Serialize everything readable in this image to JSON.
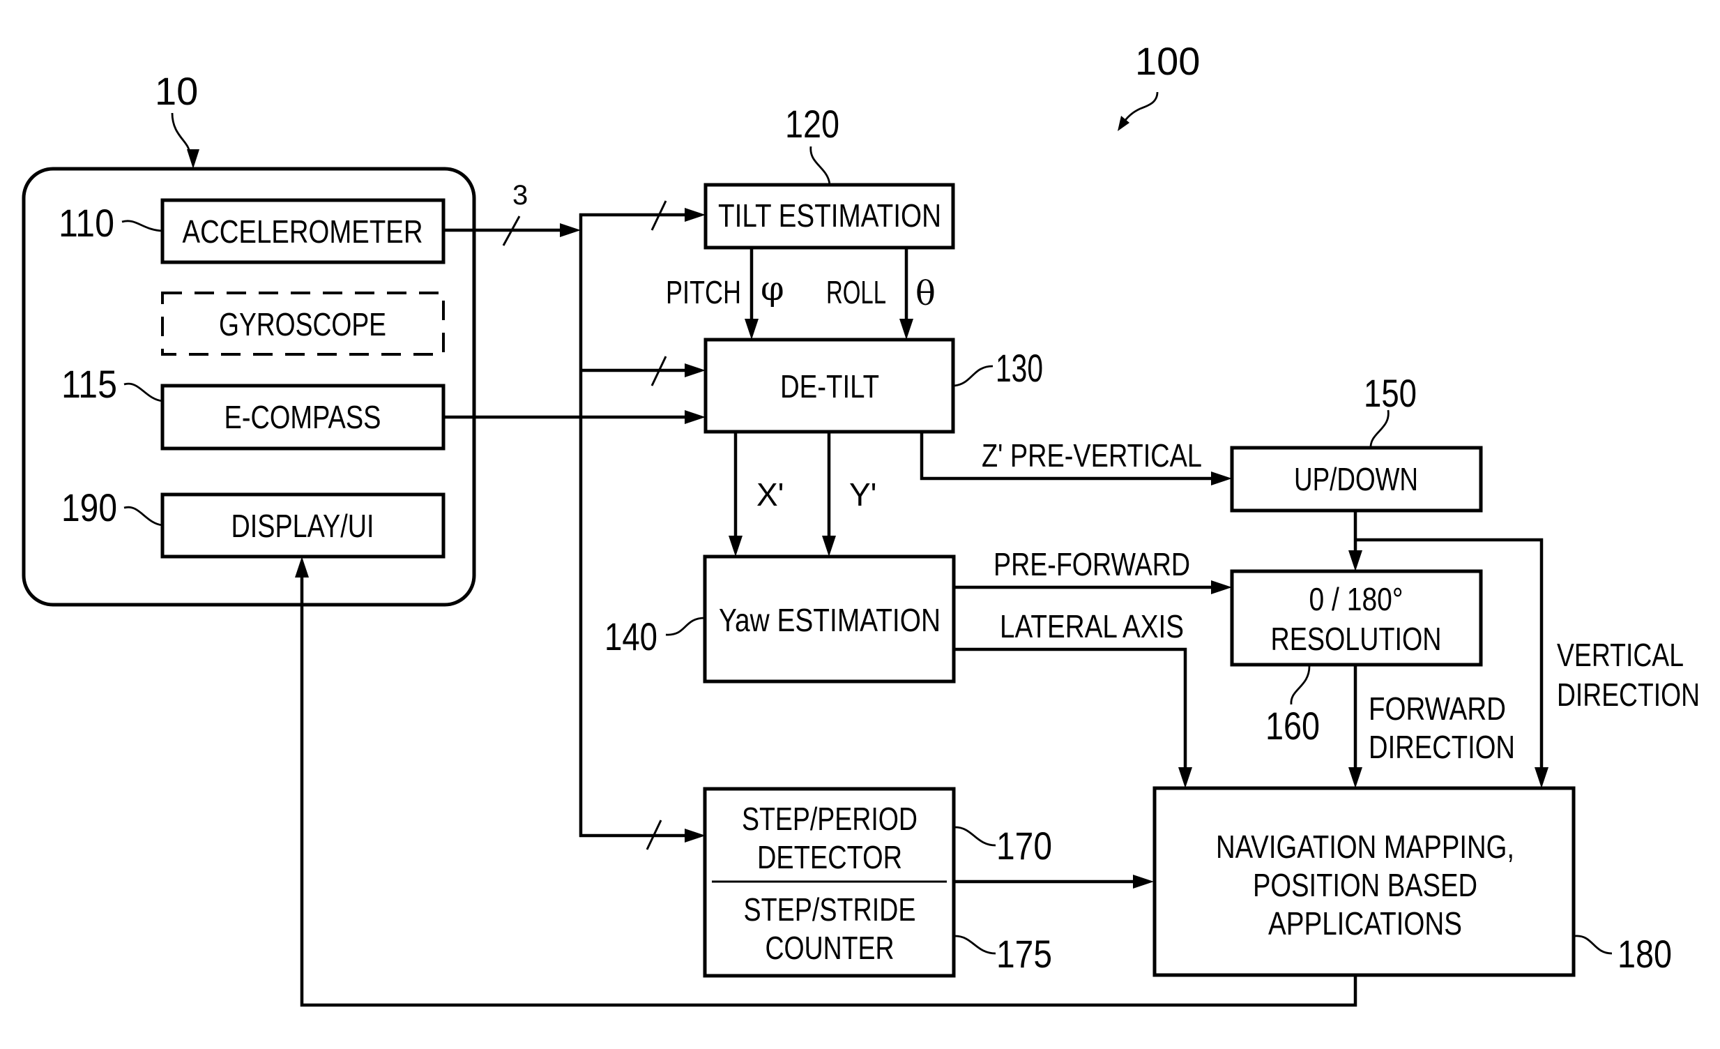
{
  "figure": {
    "reference": "100",
    "device": {
      "reference": "10",
      "components": [
        {
          "id": "accelerometer",
          "reference": "110",
          "label": "ACCELEROMETER",
          "optional": false
        },
        {
          "id": "gyroscope",
          "reference": "",
          "label": "GYROSCOPE",
          "optional": true
        },
        {
          "id": "ecompass",
          "reference": "115",
          "label": "E-COMPASS",
          "optional": false
        },
        {
          "id": "display",
          "reference": "190",
          "label": "DISPLAY/UI",
          "optional": false
        }
      ]
    },
    "blocks": {
      "tilt": {
        "reference": "120",
        "lines": [
          "TILT ESTIMATION"
        ]
      },
      "detilt": {
        "reference": "130",
        "lines": [
          "DE-TILT"
        ]
      },
      "yaw": {
        "reference": "140",
        "lines": [
          "Yaw ESTIMATION"
        ]
      },
      "updown": {
        "reference": "150",
        "lines": [
          "UP/DOWN"
        ]
      },
      "resolution": {
        "reference": "160",
        "lines": [
          "0 / 180°",
          "RESOLUTION"
        ]
      },
      "step_detector": {
        "reference": "170",
        "lines": [
          "STEP/PERIOD",
          "DETECTOR"
        ]
      },
      "step_counter": {
        "reference": "175",
        "lines": [
          "STEP/STRIDE",
          "COUNTER"
        ]
      },
      "navigation": {
        "reference": "180",
        "lines": [
          "NAVIGATION MAPPING,",
          "POSITION BASED",
          "APPLICATIONS"
        ]
      }
    },
    "signals": {
      "bus_width": "3",
      "pitch": "PITCH",
      "pitch_symbol": "φ",
      "roll": "ROLL",
      "roll_symbol": "θ",
      "x_prime": "X'",
      "y_prime": "Y'",
      "z_pre_vertical": "Z' PRE-VERTICAL",
      "pre_forward": "PRE-FORWARD",
      "lateral_axis": "LATERAL AXIS",
      "forward_direction": [
        "FORWARD",
        "DIRECTION"
      ],
      "vertical_direction": [
        "VERTICAL",
        "DIRECTION"
      ]
    }
  }
}
